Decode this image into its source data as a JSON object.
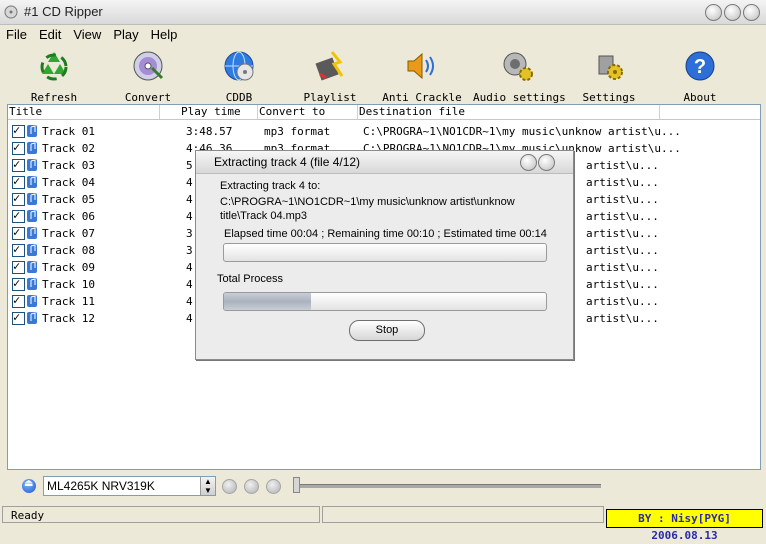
{
  "window": {
    "title": "#1 CD Ripper"
  },
  "menu": [
    {
      "label": "File"
    },
    {
      "label": "Edit"
    },
    {
      "label": "View"
    },
    {
      "label": "Play"
    },
    {
      "label": "Help"
    }
  ],
  "toolbar": [
    {
      "label": "Refresh",
      "icon": "recycle-icon"
    },
    {
      "label": "Convert",
      "icon": "cd-convert-icon"
    },
    {
      "label": "CDDB",
      "icon": "globe-cd-icon"
    },
    {
      "label": "Playlist",
      "icon": "playlist-icon"
    },
    {
      "label": "Anti Crackle",
      "icon": "speaker-wave-icon"
    },
    {
      "label": "Audio settings",
      "icon": "speaker-gear-icon"
    },
    {
      "label": "Settings",
      "icon": "gear-icon"
    },
    {
      "label": "About",
      "icon": "question-icon"
    }
  ],
  "list": {
    "columns": [
      "Title",
      "Play time",
      "Convert to",
      "Destination file"
    ],
    "tracks": [
      {
        "title": "Track 01",
        "time": "3:48.57",
        "format": "mp3  format",
        "dest": "C:\\PROGRA~1\\NO1CDR~1\\my music\\unknow artist\\u..."
      },
      {
        "title": "Track 02",
        "time": "4:46.36",
        "format": "mp3  format",
        "dest": "C:\\PROGRA~1\\NO1CDR~1\\my music\\unknow artist\\u..."
      },
      {
        "title": "Track 03",
        "time": "5",
        "format": "",
        "dest": "artist\\u..."
      },
      {
        "title": "Track 04",
        "time": "4",
        "format": "",
        "dest": "artist\\u..."
      },
      {
        "title": "Track 05",
        "time": "4",
        "format": "",
        "dest": "artist\\u..."
      },
      {
        "title": "Track 06",
        "time": "4",
        "format": "",
        "dest": "artist\\u..."
      },
      {
        "title": "Track 07",
        "time": "3",
        "format": "",
        "dest": "artist\\u..."
      },
      {
        "title": "Track 08",
        "time": "3",
        "format": "",
        "dest": "artist\\u..."
      },
      {
        "title": "Track 09",
        "time": "4",
        "format": "",
        "dest": "artist\\u..."
      },
      {
        "title": "Track 10",
        "time": "4",
        "format": "",
        "dest": "artist\\u..."
      },
      {
        "title": "Track 11",
        "time": "4",
        "format": "",
        "dest": "artist\\u..."
      },
      {
        "title": "Track 12",
        "time": "4",
        "format": "",
        "dest": "artist\\u..."
      }
    ]
  },
  "dialog": {
    "title": "Extracting track 4 (file 4/12)",
    "line1": "Extracting track 4 to:",
    "line2": "C:\\PROGRA~1\\NO1CDR~1\\my music\\unknow artist\\unknow",
    "line3": "title\\Track 04.mp3",
    "timing": "Elapsed time 00:04 ; Remaining time 00:10 ; Estimated time 00:14",
    "track_progress": 0.0,
    "total_label": "Total Process",
    "total_progress": 0.27,
    "stop_label": "Stop"
  },
  "bottom": {
    "drive": "ML4265K NRV319K"
  },
  "status": {
    "text": "Ready",
    "badge": "BY : Nisy[PYG] 2006.08.13"
  }
}
